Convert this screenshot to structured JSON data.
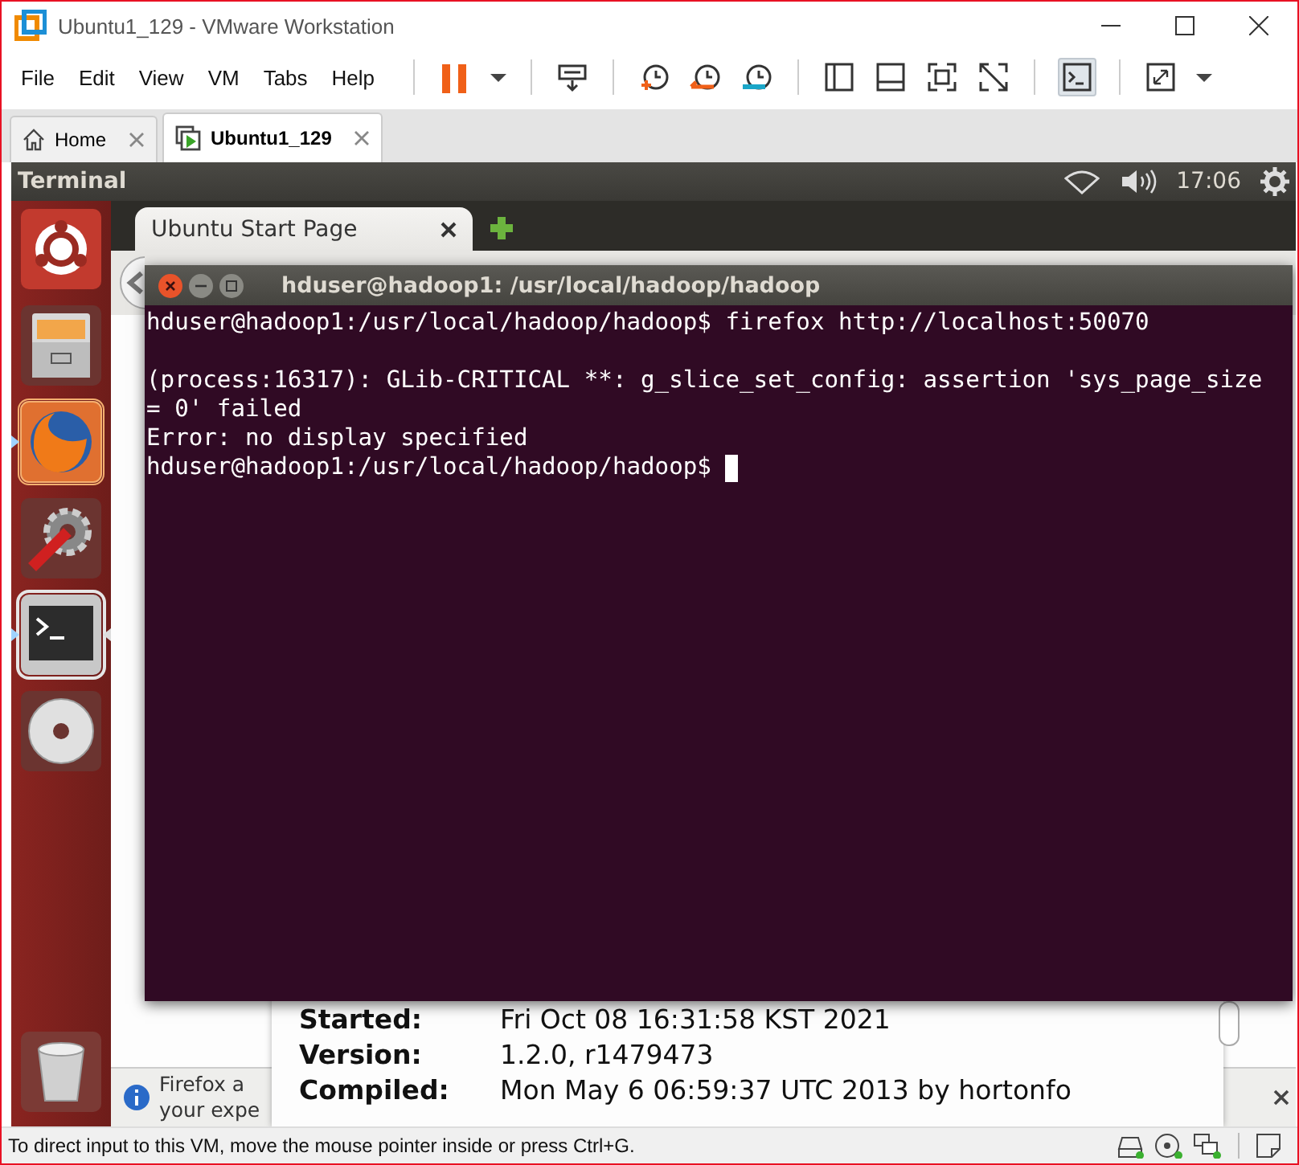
{
  "window": {
    "title": "Ubuntu1_129 - VMware Workstation"
  },
  "menu": [
    "File",
    "Edit",
    "View",
    "VM",
    "Tabs",
    "Help"
  ],
  "tabs": [
    {
      "label": "Home",
      "selected": false
    },
    {
      "label": "Ubuntu1_129",
      "selected": true
    }
  ],
  "panel": {
    "app": "Terminal",
    "time": "17:06"
  },
  "launcher": [
    {
      "kind": "dash",
      "running": false,
      "selected": false
    },
    {
      "kind": "files",
      "running": false,
      "selected": false
    },
    {
      "kind": "firefox",
      "running": true,
      "selected": false
    },
    {
      "kind": "settings",
      "running": false,
      "selected": false
    },
    {
      "kind": "terminal",
      "running": true,
      "selected": true
    },
    {
      "kind": "dvd",
      "running": false,
      "selected": false
    },
    {
      "kind": "trash",
      "running": false,
      "selected": false
    }
  ],
  "browser": {
    "tab": "Ubuntu Start Page",
    "info_bar": [
      "Firefox a",
      "your expe"
    ],
    "details": [
      {
        "label": "Started:",
        "value": "Fri Oct 08 16:31:58 KST 2021"
      },
      {
        "label": "Version:",
        "value": "1.2.0, r1479473"
      },
      {
        "label": "Compiled:",
        "value": "Mon May  6 06:59:37 UTC 2013 by hortonfo"
      }
    ]
  },
  "terminal": {
    "title": "hduser@hadoop1: /usr/local/hadoop/hadoop",
    "paragraphs": [
      [
        "hduser@hadoop1:/usr/local/hadoop/hadoop$ firefox http://localhost:50070"
      ],
      [
        "(process:16317): GLib-CRITICAL **: g_slice_set_config: assertion 'sys_page_size",
        "= 0' failed",
        "Error: no display specified",
        "hduser@hadoop1:/usr/local/hadoop/hadoop$"
      ]
    ]
  },
  "status_bar": {
    "text": "To direct input to this VM, move the mouse pointer inside or press Ctrl+G."
  }
}
